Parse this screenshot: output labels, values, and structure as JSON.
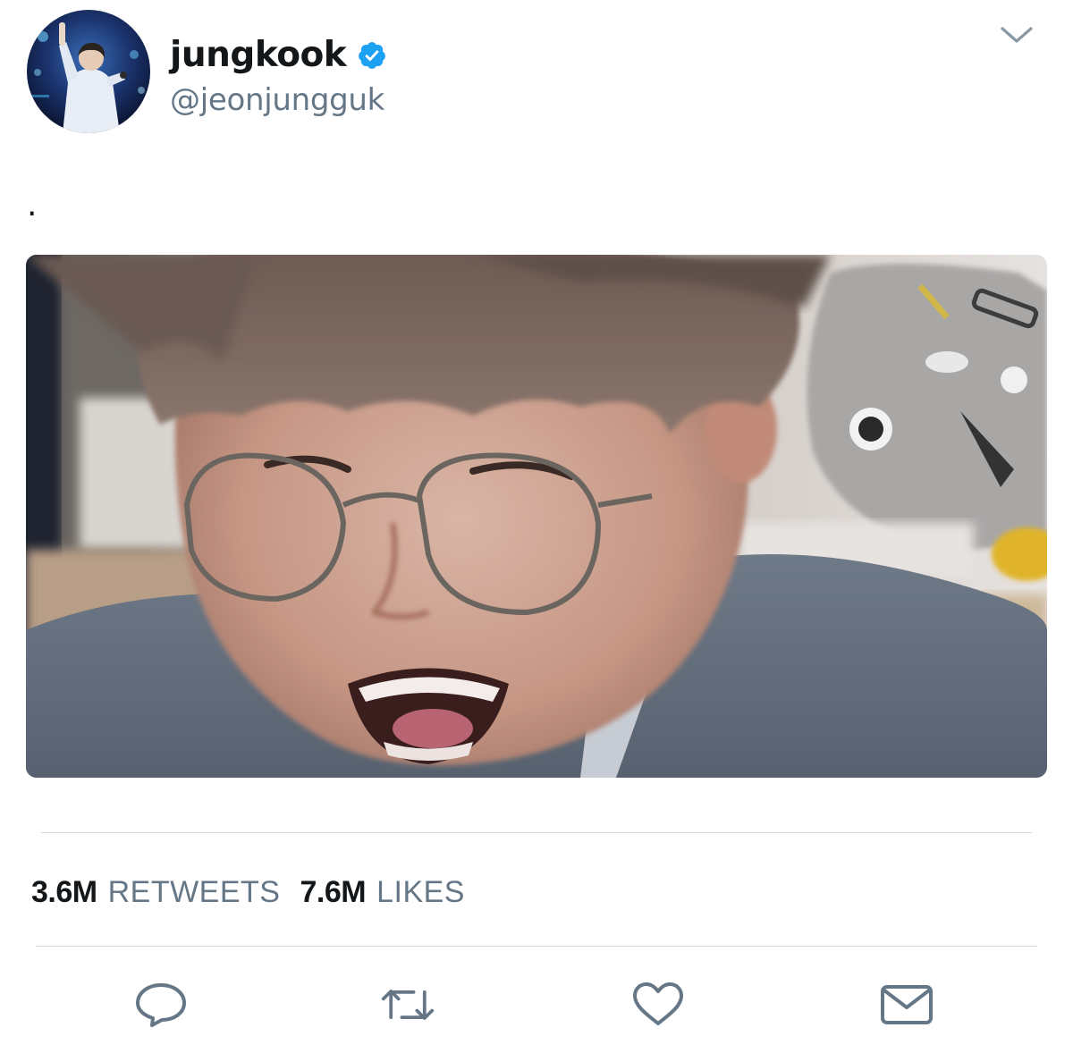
{
  "tweet": {
    "author": {
      "display_name": "jungkook",
      "handle": "@jeonjungguk",
      "verified": true
    },
    "text": ".",
    "has_media": true
  },
  "stats": {
    "retweets_count": "3.6M",
    "retweets_label": "RETWEETS",
    "likes_count": "7.6M",
    "likes_label": "LIKES"
  },
  "actions": [
    "reply-icon",
    "retweet-icon",
    "like-icon",
    "direct-message-icon"
  ],
  "colors": {
    "text_primary": "#14171a",
    "text_secondary": "#657786",
    "verified_blue": "#1da1f2",
    "divider": "#cfd6dc",
    "icon_gray": "#657786"
  }
}
